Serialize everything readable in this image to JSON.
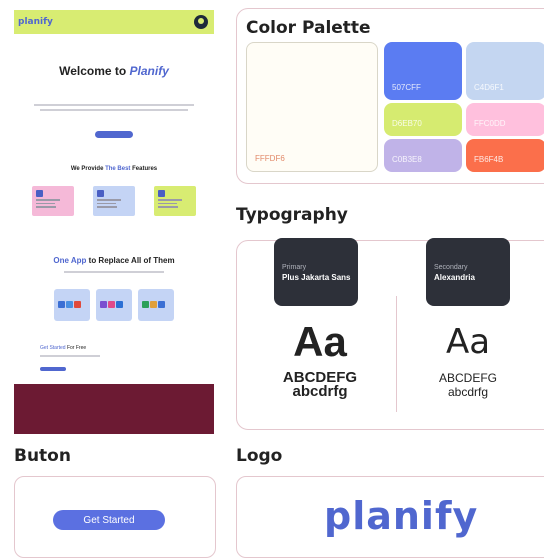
{
  "preview": {
    "logo": "planify",
    "hero_title_prefix": "Welcome to ",
    "hero_title_accent": "Planify",
    "features_prefix": "We Provide ",
    "features_accent": "The Best",
    "features_suffix": " Features",
    "app_title_accent": "One App",
    "app_title_suffix": " to Replace All of Them",
    "get_started_accent": "Get Started",
    "get_started_suffix": " For Free",
    "card_colors": [
      "#f5b9d8",
      "#c4d4f5",
      "#d8ec72"
    ],
    "footer_color": "#6c1a33"
  },
  "palette": {
    "heading": "Color Palette",
    "swatches": [
      {
        "hex": "FFFDF6",
        "color": "#fffdf6"
      },
      {
        "hex": "507CFF",
        "color": "#5b7cf2"
      },
      {
        "hex": "C4D6F1",
        "color": "#c4d6f1"
      },
      {
        "hex": "D6EB70",
        "color": "#d6eb70"
      },
      {
        "hex": "FFC0DD",
        "color": "#ffc0dd"
      },
      {
        "hex": "C0B3E8",
        "color": "#c0b3e8"
      },
      {
        "hex": "FB6F4B",
        "color": "#fb6f4b"
      }
    ]
  },
  "typography": {
    "heading": "Typography",
    "primary": {
      "role": "Primary",
      "font": "Plus Jakarta Sans",
      "sample": "Aa",
      "upper": "ABCDEFG",
      "lower": "abcdrfg"
    },
    "secondary": {
      "role": "Secondary",
      "font": "Alexandria",
      "sample": "Aa",
      "upper": "ABCDEFG",
      "lower": "abcdrfg"
    }
  },
  "button": {
    "heading": "Buton",
    "label": "Get Started",
    "color": "#5b70e1"
  },
  "logo": {
    "heading": "Logo",
    "text": "planify",
    "color": "#5067cf"
  }
}
